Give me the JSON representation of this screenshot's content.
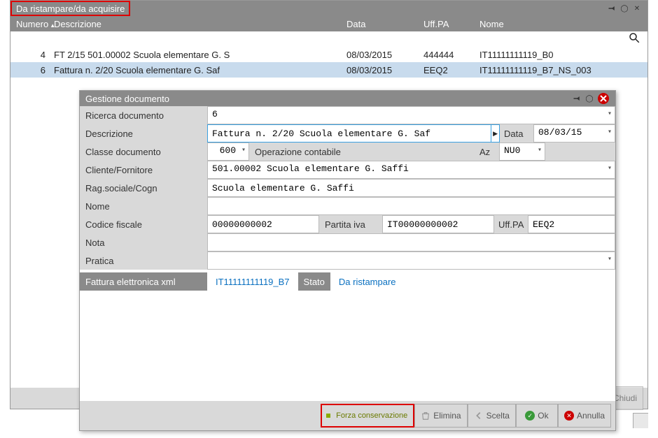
{
  "main_window": {
    "title": "Da ristampare/da acquisire",
    "columns": {
      "numero": "Numero",
      "descrizione": "Descrizione",
      "data": "Data",
      "uffpa": "Uff.PA",
      "nome": "Nome"
    },
    "rows": [
      {
        "num": "4",
        "desc": "FT 2/15 501.00002 Scuola elementare G. S",
        "data": "08/03/2015",
        "uffpa": "444444",
        "nome": "IT11111111119_B0"
      },
      {
        "num": "6",
        "desc": "Fattura n. 2/20 Scuola elementare G. Saf",
        "data": "08/03/2015",
        "uffpa": "EEQ2",
        "nome": "IT11111111119_B7_NS_003"
      }
    ],
    "chiudi": "Chiudi"
  },
  "dialog": {
    "title": "Gestione documento",
    "labels": {
      "ricerca": "Ricerca documento",
      "descrizione": "Descrizione",
      "data": "Data",
      "classe": "Classe documento",
      "operazione": "Operazione contabile",
      "az": "Az",
      "cliente": "Cliente/Fornitore",
      "rag": "Rag.sociale/Cogn",
      "nome": "Nome",
      "codfisc": "Codice fiscale",
      "piva": "Partita iva",
      "uffpa": "Uff.PA",
      "nota": "Nota",
      "pratica": "Pratica",
      "fatxml": "Fattura elettronica xml",
      "stato": "Stato"
    },
    "values": {
      "ricerca": "6",
      "descrizione": "Fattura n. 2/20 Scuola elementare G. Saf",
      "data": "08/03/15",
      "classe": "600",
      "az": "NU0",
      "cliente": "501.00002 Scuola elementare G. Saffi",
      "rag": "Scuola elementare G. Saffi",
      "nome": "",
      "codfisc": "00000000002",
      "piva": "IT00000000002",
      "uffpa": "EEQ2",
      "nota": "",
      "pratica": "",
      "fatxml": "IT11111111119_B7",
      "stato": "Da ristampare"
    },
    "buttons": {
      "forza": "Forza conservazione",
      "elimina": "Elimina",
      "scelta": "Scelta",
      "ok": "Ok",
      "annulla": "Annulla"
    }
  }
}
